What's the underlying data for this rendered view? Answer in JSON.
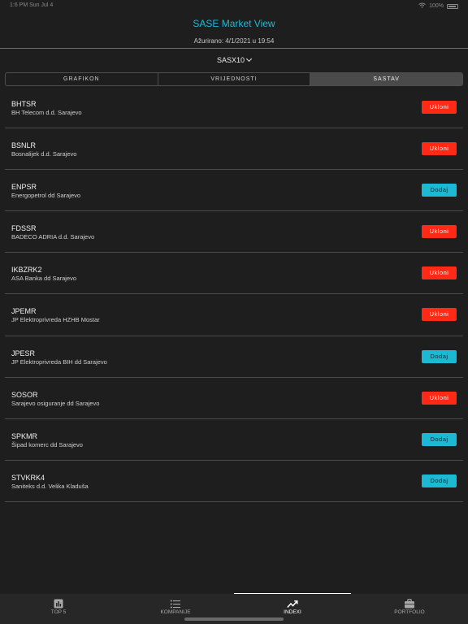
{
  "status_bar": {
    "left": "1:6 PM  Sun Jul 4",
    "right": "100%"
  },
  "header": {
    "title": "SASE Market View",
    "updated": "Ažurirano: 4/1/2021 u 19:54",
    "index_selector": "SASX10"
  },
  "segments": [
    {
      "label": "GRAFIKON"
    },
    {
      "label": "VRIJEDNOSTI"
    },
    {
      "label": "SASTAV",
      "active": true
    }
  ],
  "items": [
    {
      "symbol": "BHTSR",
      "name": "BH Telecom d.d. Sarajevo",
      "action": "Ukloni"
    },
    {
      "symbol": "BSNLR",
      "name": "Bosnalijek d.d. Sarajevo",
      "action": "Ukloni"
    },
    {
      "symbol": "ENPSR",
      "name": "Energopetrol dd Sarajevo",
      "action": "Dodaj"
    },
    {
      "symbol": "FDSSR",
      "name": "BADECO ADRIA d.d. Sarajevo",
      "action": "Ukloni"
    },
    {
      "symbol": "IKBZRK2",
      "name": "ASA Banka dd Sarajevo",
      "action": "Ukloni"
    },
    {
      "symbol": "JPEMR",
      "name": "JP Elektroprivreda HZHB Mostar",
      "action": "Ukloni"
    },
    {
      "symbol": "JPESR",
      "name": "JP Elektroprivreda BIH dd Sarajevo",
      "action": "Dodaj"
    },
    {
      "symbol": "SOSOR",
      "name": "Sarajevo osiguranje dd Sarajevo",
      "action": "Ukloni"
    },
    {
      "symbol": "SPKMR",
      "name": "Šipad komerc dd Sarajevo",
      "action": "Dodaj"
    },
    {
      "symbol": "STVKRK4",
      "name": "Saniteks d.d. Velika Kladuša",
      "action": "Dodaj"
    }
  ],
  "tabbar": [
    {
      "label": "TOP 5",
      "icon": "bar-chart-icon"
    },
    {
      "label": "KOMPANIJE",
      "icon": "list-icon"
    },
    {
      "label": "INDEXI",
      "icon": "trend-up-icon",
      "active": true
    },
    {
      "label": "PORTFOLIO",
      "icon": "briefcase-icon"
    }
  ],
  "colors": {
    "accent": "#1fb8d6",
    "remove": "#ff2a16",
    "add": "#1bb9d3",
    "background": "#1e1e1e"
  }
}
